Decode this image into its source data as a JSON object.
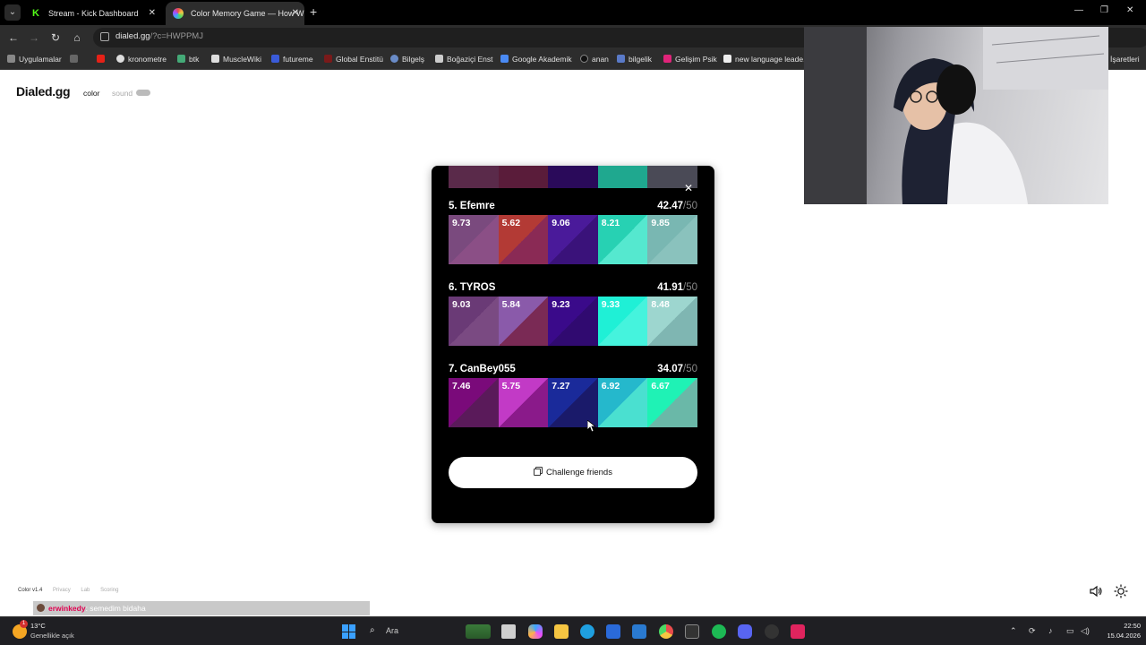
{
  "browser": {
    "tabs": [
      {
        "title": "Stream - Kick Dashboard",
        "favicon": "kick-icon"
      },
      {
        "title": "Color Memory Game — How W",
        "favicon": "dialed-icon"
      }
    ],
    "url_host": "dialed.gg",
    "url_path": "/?c=HWPPMJ",
    "bookmarks": [
      "Uygulamalar",
      "kronometre",
      "btk",
      "MuscleWiki",
      "futureme",
      "Global Enstitü",
      "Bilgelş",
      "Boğaziçi Enst",
      "Google Akademik",
      "anan",
      "bilgelik",
      "Gelişim Psik",
      "new language leade...",
      "İşaretleri"
    ]
  },
  "site": {
    "logo": "Dialed.gg",
    "nav_color": "color",
    "nav_sound": "sound",
    "footer": [
      "Color v1.4",
      "Privacy",
      "Lab",
      "Scoring"
    ]
  },
  "leaderboard": {
    "top_strip_colors": [
      "#5a2a4a",
      "#5a1c3a",
      "#2a0a5a",
      "#1fa88f",
      "#4a4a56"
    ],
    "entries": [
      {
        "name": "5. Efemre",
        "score": "42.47",
        "max": "/50",
        "swatches": [
          {
            "value": "9.73",
            "target": "#7a4a7e",
            "guess": "#8b4f86"
          },
          {
            "value": "5.62",
            "target": "#b33a35",
            "guess": "#8a2a55"
          },
          {
            "value": "9.06",
            "target": "#4a1a9a",
            "guess": "#3a127a"
          },
          {
            "value": "8.21",
            "target": "#27d1b3",
            "guess": "#55e8cf"
          },
          {
            "value": "9.85",
            "target": "#79b7b2",
            "guess": "#8ac2bd"
          }
        ]
      },
      {
        "name": "6. TYROS",
        "score": "41.91",
        "max": "/50",
        "swatches": [
          {
            "value": "9.03",
            "target": "#6a3a76",
            "guess": "#7a4a82"
          },
          {
            "value": "5.84",
            "target": "#8a5aaa",
            "guess": "#7a2a55"
          },
          {
            "value": "9.23",
            "target": "#3a0a8a",
            "guess": "#300a70"
          },
          {
            "value": "9.33",
            "target": "#1ff0d6",
            "guess": "#45f3dd"
          },
          {
            "value": "8.48",
            "target": "#9dd6cf",
            "guess": "#7fb6b2"
          }
        ]
      },
      {
        "name": "7. CanBey055",
        "score": "34.07",
        "max": "/50",
        "swatches": [
          {
            "value": "7.46",
            "target": "#7a0a7a",
            "guess": "#5a1a5a"
          },
          {
            "value": "5.75",
            "target": "#c23ac6",
            "guess": "#8a1a8a"
          },
          {
            "value": "7.27",
            "target": "#1a2a9a",
            "guess": "#1a1a6a"
          },
          {
            "value": "6.92",
            "target": "#25b8cc",
            "guess": "#4ae0d0"
          },
          {
            "value": "6.67",
            "target": "#1ff2b5",
            "guess": "#6ab8a8"
          }
        ]
      }
    ],
    "cta_label": "Challenge friends"
  },
  "chat": {
    "user": "erwinkedy",
    "message": ": semedim bidaha"
  },
  "taskbar": {
    "weather_badge": "1",
    "temperature": "13°C",
    "weather_desc": "Genellikle açık",
    "search_placeholder": "Ara",
    "time": "22:50",
    "date": "15.04.2026"
  }
}
